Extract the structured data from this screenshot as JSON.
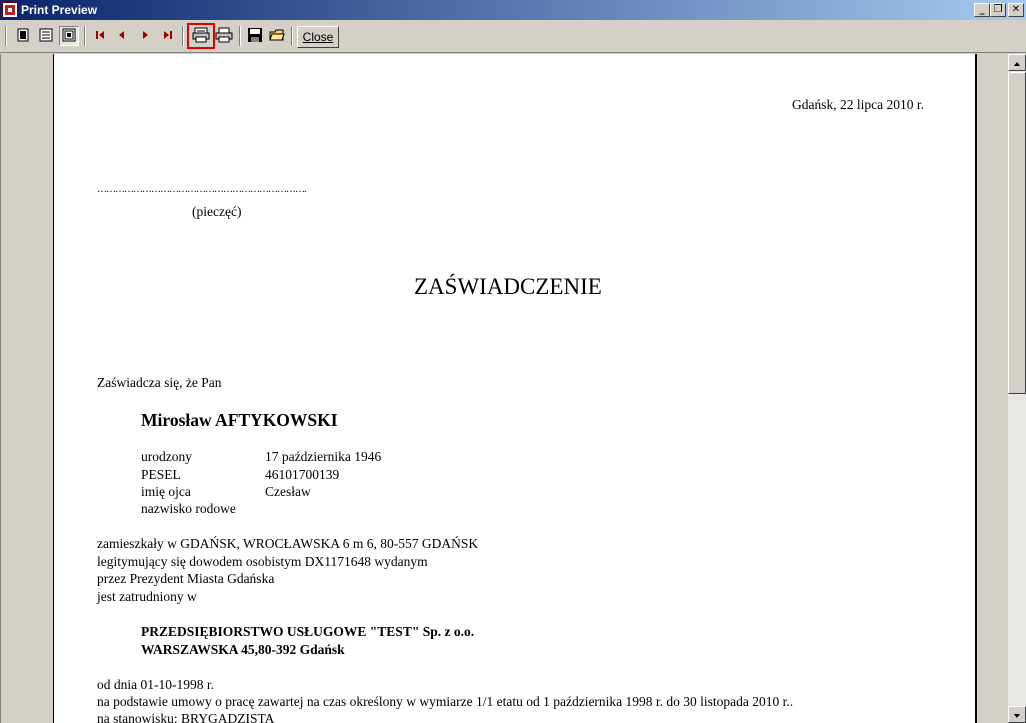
{
  "window": {
    "title": "Print Preview",
    "minimize_glyph": "_",
    "restore_glyph": "❐",
    "close_glyph": "✕"
  },
  "toolbar": {
    "close_label": "Close",
    "buttons": [
      "one-page-icon",
      "multi-page-icon",
      "zoom-page-icon",
      "first-page-icon",
      "prev-page-icon",
      "next-page-icon",
      "last-page-icon",
      "print-setup-icon",
      "print-icon",
      "save-icon",
      "open-icon"
    ]
  },
  "document": {
    "place_date": "Gdańsk, 22 lipca 2010 r.",
    "seal_line": "…………………………………………………………….",
    "seal_label": "(pieczęć)",
    "heading": "ZAŚWIADCZENIE",
    "intro": "Zaświadcza się, że Pan",
    "person_name": "Mirosław  AFTYKOWSKI",
    "fields": [
      {
        "label": "urodzony",
        "value": "17 października 1946"
      },
      {
        "label": "PESEL",
        "value": "46101700139"
      },
      {
        "label": "imię ojca",
        "value": "Czesław"
      },
      {
        "label": "nazwisko rodowe",
        "value": ""
      }
    ],
    "address_line": "zamieszkały w GDAŃSK, WROCŁAWSKA 6 m 6, 80-557 GDAŃSK",
    "id_line": "legitymujący się dowodem osobistym DX1171648 wydanym",
    "issuer_line": "przez Prezydent Miasta Gdańska",
    "employed_line": "jest zatrudniony w",
    "company_name": "PRZEDSIĘBIORSTWO USŁUGOWE \"TEST\" Sp. z o.o.",
    "company_address": "WARSZAWSKA 45,80-392 Gdańsk",
    "since_line": "od dnia  01-10-1998 r.",
    "contract_line": "na podstawie umowy o pracę zawartej na czas określony  w wymiarze 1/1 etatu od 1 października 1998 r. do 30 listopada 2010 r..",
    "position_line": "na stanowisku: BRYGADZISTA"
  }
}
